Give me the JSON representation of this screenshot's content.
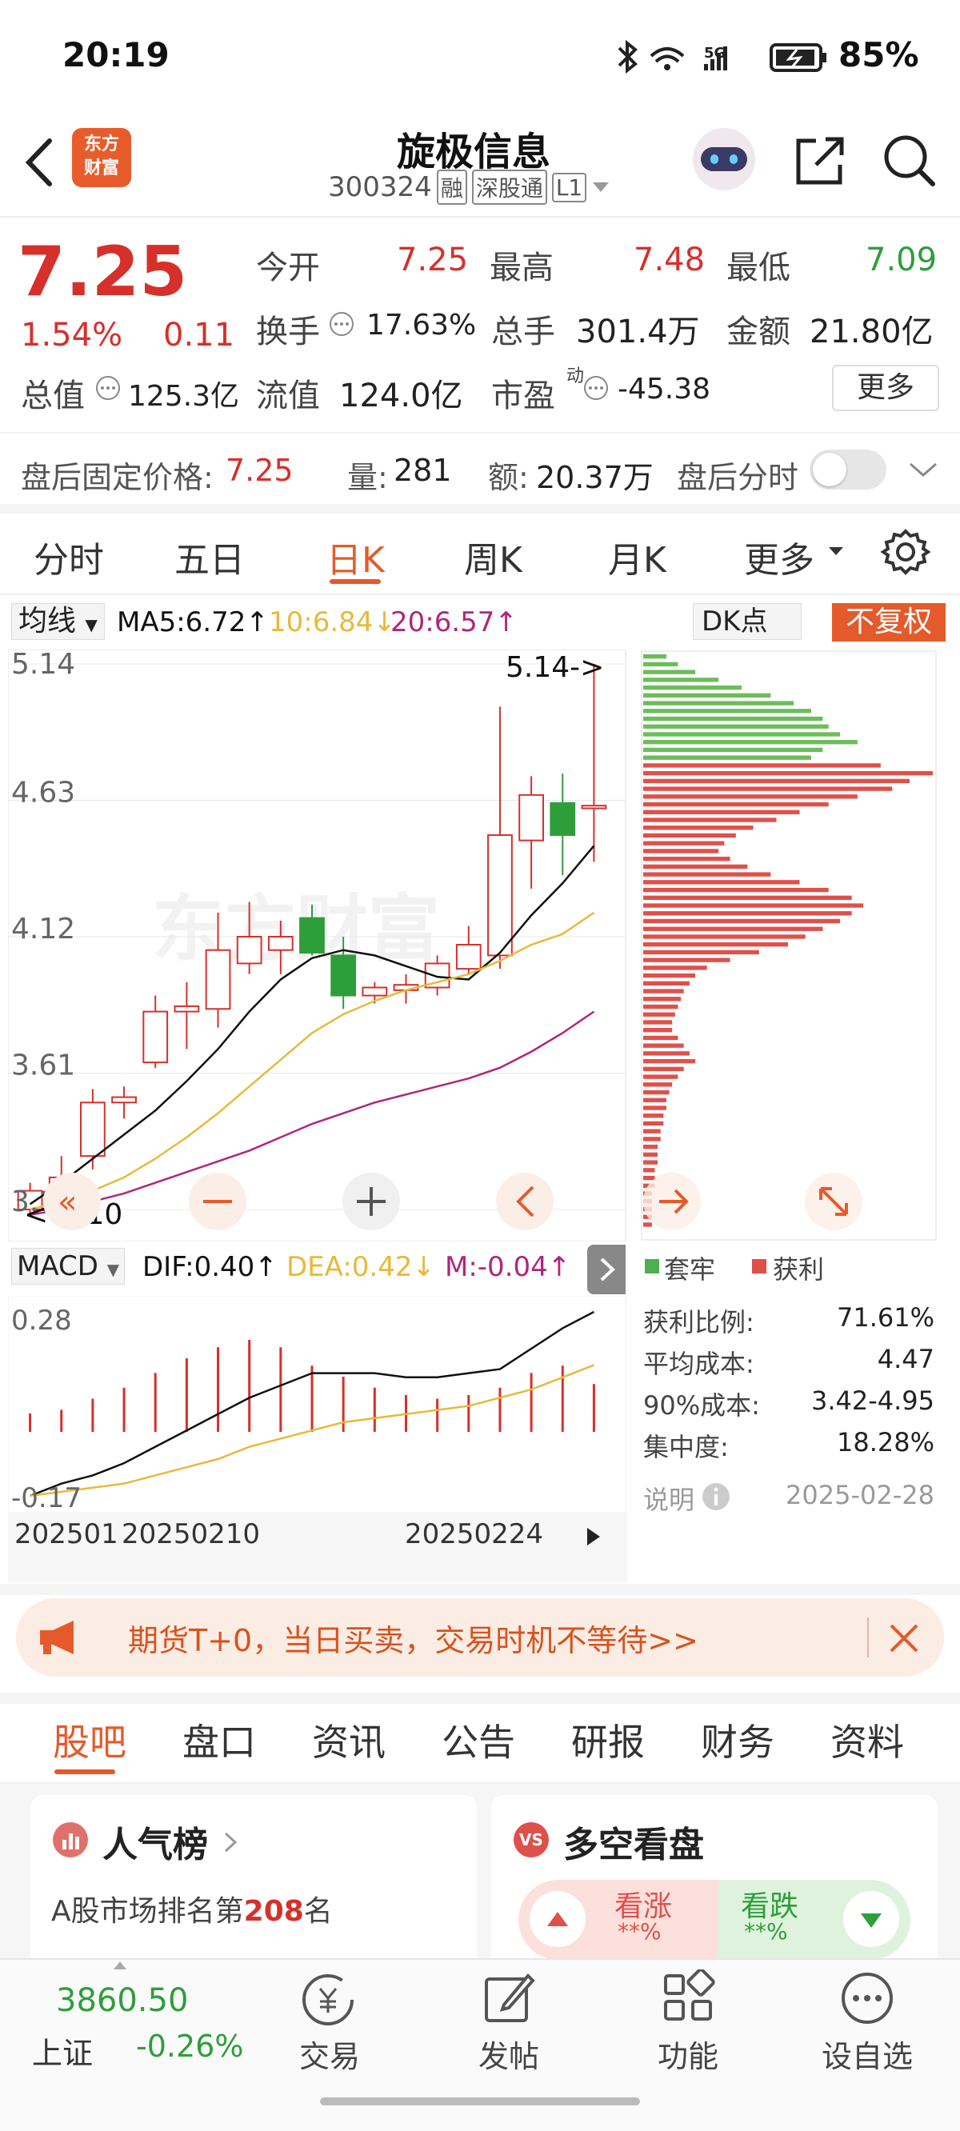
{
  "status": {
    "time": "20:19",
    "signal_label": "5G",
    "battery": "85%"
  },
  "header": {
    "title": "旋极信息",
    "code": "300324",
    "badges": [
      "融",
      "深股通",
      "L1"
    ],
    "logo_text_1": "东方",
    "logo_text_2": "财富"
  },
  "quote": {
    "price": "7.25",
    "change_pct": "1.54%",
    "change": "0.11",
    "open_label": "今开",
    "open": "7.25",
    "high_label": "最高",
    "high": "7.48",
    "low_label": "最低",
    "low": "7.09",
    "turnover_label": "换手",
    "turnover": "17.63%",
    "volume_label": "总手",
    "volume": "301.4万",
    "amount_label": "金额",
    "amount": "21.80亿",
    "mktcap_label": "总值",
    "mktcap": "125.3亿",
    "float_label": "流值",
    "float": "124.0亿",
    "pe_label": "市盈",
    "pe_sup": "动",
    "pe": "-45.38",
    "more": "更多"
  },
  "after_hours": {
    "price_label": "盘后固定价格:",
    "price": "7.25",
    "vol_label": "量:",
    "vol": "281",
    "amt_label": "额:",
    "amt": "20.37万",
    "toggle_label": "盘后分时",
    "toggle_on": false
  },
  "chart_tabs": [
    "分时",
    "五日",
    "日K",
    "周K",
    "月K",
    "更多"
  ],
  "chart_tab_active": 2,
  "indicator_bar": {
    "ma_select": "均线",
    "ma5": "MA5:6.72↑",
    "ma10": "10:6.84↓",
    "ma20": "20:6.57↑",
    "dk": "DK点",
    "adjust": "不复权"
  },
  "colors": {
    "up": "#d6302b",
    "down": "#2e9e3a",
    "ma5": "#111111",
    "ma10": "#e8b93a",
    "ma20": "#b0267a",
    "accent": "#e55a2b"
  },
  "chart_data": [
    {
      "type": "candlestick",
      "y_ticks": [
        "5.14",
        "4.63",
        "4.12",
        "3.61",
        "3.10"
      ],
      "ylim": [
        3.1,
        5.14
      ],
      "max_marker": "5.14->",
      "min_marker": "3.10",
      "x_labels": [
        "20250127",
        "20250210",
        "20250224"
      ],
      "candles": [
        {
          "o": 3.1,
          "c": 3.17,
          "h": 3.2,
          "l": 3.08
        },
        {
          "o": 3.14,
          "c": 3.22,
          "h": 3.3,
          "l": 3.12
        },
        {
          "o": 3.3,
          "c": 3.5,
          "h": 3.55,
          "l": 3.25
        },
        {
          "o": 3.5,
          "c": 3.52,
          "h": 3.56,
          "l": 3.44
        },
        {
          "o": 3.65,
          "c": 3.84,
          "h": 3.9,
          "l": 3.63
        },
        {
          "o": 3.84,
          "c": 3.86,
          "h": 3.95,
          "l": 3.7
        },
        {
          "o": 3.85,
          "c": 4.07,
          "h": 4.21,
          "l": 3.78
        },
        {
          "o": 4.02,
          "c": 4.12,
          "h": 4.25,
          "l": 3.98
        },
        {
          "o": 4.07,
          "c": 4.12,
          "h": 4.18,
          "l": 3.98
        },
        {
          "o": 4.19,
          "c": 4.06,
          "h": 4.24,
          "l": 4.05
        },
        {
          "o": 4.05,
          "c": 3.9,
          "h": 4.12,
          "l": 3.85
        },
        {
          "o": 3.9,
          "c": 3.93,
          "h": 3.95,
          "l": 3.87
        },
        {
          "o": 3.92,
          "c": 3.94,
          "h": 3.98,
          "l": 3.87
        },
        {
          "o": 3.93,
          "c": 4.02,
          "h": 4.05,
          "l": 3.9
        },
        {
          "o": 4.0,
          "c": 4.09,
          "h": 4.16,
          "l": 3.98
        },
        {
          "o": 4.05,
          "c": 4.5,
          "h": 4.98,
          "l": 4.0
        },
        {
          "o": 4.48,
          "c": 4.65,
          "h": 4.72,
          "l": 4.3
        },
        {
          "o": 4.62,
          "c": 4.5,
          "h": 4.73,
          "l": 4.35
        },
        {
          "o": 4.6,
          "c": 4.61,
          "h": 5.14,
          "l": 4.4
        }
      ],
      "ma5": [
        3.12,
        3.2,
        3.29,
        3.38,
        3.47,
        3.58,
        3.7,
        3.84,
        3.96,
        4.04,
        4.07,
        4.05,
        4.01,
        3.97,
        3.96,
        4.06,
        4.2,
        4.32,
        4.46
      ],
      "ma10": [
        3.1,
        3.13,
        3.17,
        3.22,
        3.29,
        3.37,
        3.46,
        3.56,
        3.66,
        3.76,
        3.83,
        3.88,
        3.92,
        3.95,
        3.98,
        4.03,
        4.09,
        4.13,
        4.21
      ],
      "ma20": [
        3.08,
        3.1,
        3.13,
        3.16,
        3.2,
        3.24,
        3.28,
        3.32,
        3.37,
        3.42,
        3.46,
        3.5,
        3.53,
        3.56,
        3.59,
        3.63,
        3.69,
        3.76,
        3.84
      ]
    },
    {
      "type": "macd",
      "y_ticks": [
        "0.28",
        "-0.17"
      ],
      "ylim": [
        -0.17,
        0.28
      ],
      "dif_label": "DIF:0.40↑",
      "dea_label": "DEA:0.42↓",
      "m_label": "M:-0.04↑",
      "select": "MACD",
      "bars": [
        0.05,
        0.06,
        0.09,
        0.12,
        0.16,
        0.2,
        0.23,
        0.25,
        0.23,
        0.18,
        0.15,
        0.12,
        0.1,
        0.09,
        0.1,
        0.12,
        0.16,
        0.18,
        0.13
      ],
      "dif": [
        -0.17,
        -0.14,
        -0.12,
        -0.09,
        -0.05,
        -0.01,
        0.03,
        0.07,
        0.1,
        0.13,
        0.13,
        0.13,
        0.12,
        0.12,
        0.13,
        0.14,
        0.19,
        0.24,
        0.28
      ],
      "dea": [
        -0.17,
        -0.16,
        -0.15,
        -0.14,
        -0.12,
        -0.1,
        -0.08,
        -0.05,
        -0.03,
        -0.01,
        0.01,
        0.02,
        0.03,
        0.04,
        0.05,
        0.07,
        0.09,
        0.12,
        0.15
      ]
    },
    {
      "type": "bar",
      "orientation": "horizontal",
      "title": "筹码分布",
      "legend": [
        "套牢",
        "获利"
      ],
      "profit_share": [
        0,
        0,
        0,
        0,
        0,
        0,
        0,
        0,
        0,
        0,
        0,
        0,
        0,
        0,
        1,
        1,
        1,
        1,
        1,
        1,
        1,
        1,
        1,
        1,
        1,
        1,
        1,
        1,
        1,
        1,
        1,
        1,
        1,
        1,
        1,
        1,
        1,
        1,
        1,
        1,
        1,
        1,
        1,
        1,
        1,
        1,
        1,
        1,
        1,
        1,
        1,
        1,
        1,
        1,
        1,
        1,
        1,
        1,
        1,
        1,
        1,
        1,
        1,
        1,
        1,
        1,
        1,
        1,
        1,
        1,
        1,
        1,
        1,
        1
      ],
      "lengths": [
        0.08,
        0.12,
        0.18,
        0.26,
        0.34,
        0.44,
        0.52,
        0.58,
        0.62,
        0.64,
        0.68,
        0.74,
        0.62,
        0.58,
        0.82,
        1.0,
        0.92,
        0.86,
        0.74,
        0.64,
        0.54,
        0.46,
        0.38,
        0.32,
        0.28,
        0.26,
        0.3,
        0.36,
        0.44,
        0.54,
        0.64,
        0.72,
        0.76,
        0.72,
        0.68,
        0.62,
        0.56,
        0.5,
        0.4,
        0.3,
        0.22,
        0.18,
        0.16,
        0.14,
        0.13,
        0.12,
        0.11,
        0.1,
        0.1,
        0.12,
        0.14,
        0.16,
        0.18,
        0.14,
        0.12,
        0.1,
        0.09,
        0.08,
        0.08,
        0.07,
        0.07,
        0.06,
        0.06,
        0.05,
        0.05,
        0.05,
        0.04,
        0.04,
        0.04,
        0.03,
        0.03,
        0.03,
        0.03,
        0.03
      ]
    }
  ],
  "chip_legend": {
    "trap": "套牢",
    "profit": "获利"
  },
  "chip_stats": [
    {
      "label": "获利比例:",
      "value": "71.61%"
    },
    {
      "label": "平均成本:",
      "value": "4.47"
    },
    {
      "label": "90%成本:",
      "value": "3.42-4.95"
    },
    {
      "label": "集中度:",
      "value": "18.28%"
    }
  ],
  "chip_note": "说明",
  "chip_date": "2025-02-28",
  "banner": {
    "text": "期货T+0，当日买卖，交易时机不等待>>"
  },
  "bottom_tabs": [
    "股吧",
    "盘口",
    "资讯",
    "公告",
    "研报",
    "财务",
    "资料"
  ],
  "bottom_tab_active": 0,
  "cards": {
    "popularity_title": "人气榜",
    "rank_prefix": "A股市场排名第",
    "rank": "208",
    "rank_suffix": "名",
    "sentiment_title": "多空看盘",
    "bull_label": "看涨",
    "bull_pct": "**%",
    "bear_label": "看跌",
    "bear_pct": "**%"
  },
  "footer": {
    "index_value": "3860.50",
    "index_name": "上证",
    "index_change": "-0.26%",
    "nav": [
      "交易",
      "发帖",
      "功能",
      "设自选"
    ]
  }
}
